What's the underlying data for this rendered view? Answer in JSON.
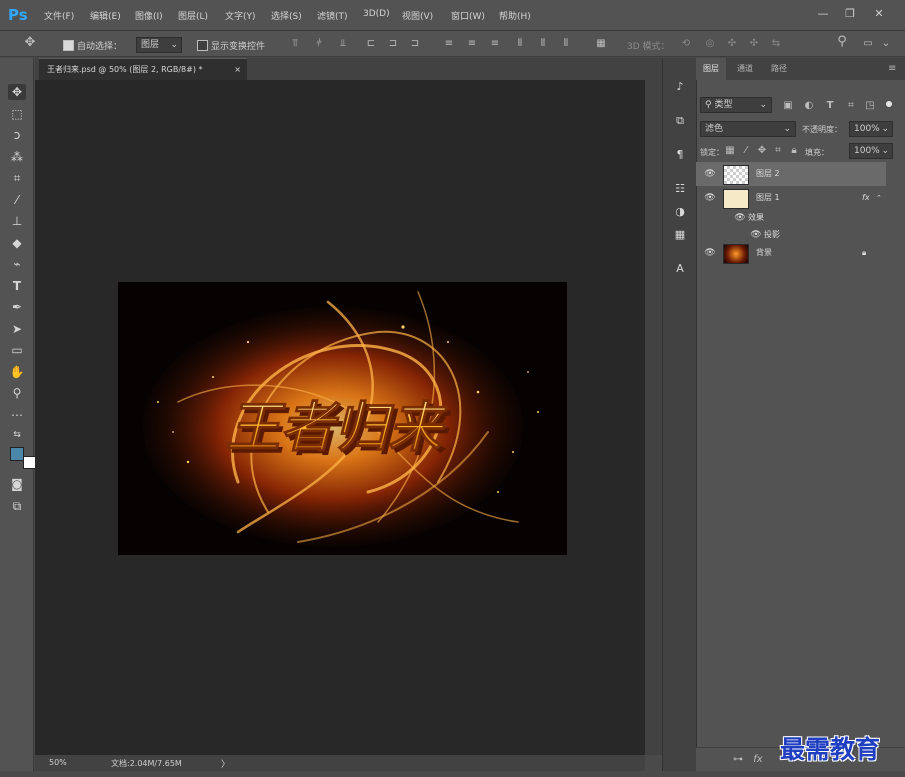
{
  "app": {
    "logo": "Ps"
  },
  "menu": [
    "文件(F)",
    "编辑(E)",
    "图像(I)",
    "图层(L)",
    "文字(Y)",
    "选择(S)",
    "滤镜(T)",
    "3D(D)",
    "视图(V)",
    "窗口(W)",
    "帮助(H)"
  ],
  "window_controls": {
    "minimize": "—",
    "restore": "❐",
    "close": "✕"
  },
  "options": {
    "auto_select_label": "自动选择：",
    "auto_select_value": "图层",
    "show_transform_label": "显示变换控件",
    "mode_3d_label": "3D 模式："
  },
  "document": {
    "tab_title": "王者归来.psd @ 50% (图层 2, RGB/8#) *",
    "tab_close": "×",
    "zoom": "50%",
    "doc_info": "文档:2.04M/7.65M",
    "status_arrow": "〉"
  },
  "artwork": {
    "text": "王者归来"
  },
  "panel_tabs": [
    "图层",
    "通道",
    "路径"
  ],
  "layers_panel": {
    "filter_kind": "类型",
    "blend_mode": "滤色",
    "opacity_label": "不透明度：",
    "opacity_value": "100%",
    "lock_label": "锁定：",
    "fill_label": "填充：",
    "fill_value": "100%",
    "layers": [
      {
        "name": "图层 2",
        "visible": true,
        "selected": true
      },
      {
        "name": "图层 1",
        "visible": true,
        "fx": "fx"
      },
      {
        "name": "效果",
        "visible": true,
        "indent": 1
      },
      {
        "name": "投影",
        "visible": true,
        "indent": 2
      },
      {
        "name": "背景",
        "visible": true,
        "locked": true
      }
    ]
  },
  "watermark": "最需教育",
  "colors": {
    "accent": "#31a8ff",
    "foreground": "#4a87a8",
    "background": "#ffffff",
    "canvas": "#282828"
  }
}
